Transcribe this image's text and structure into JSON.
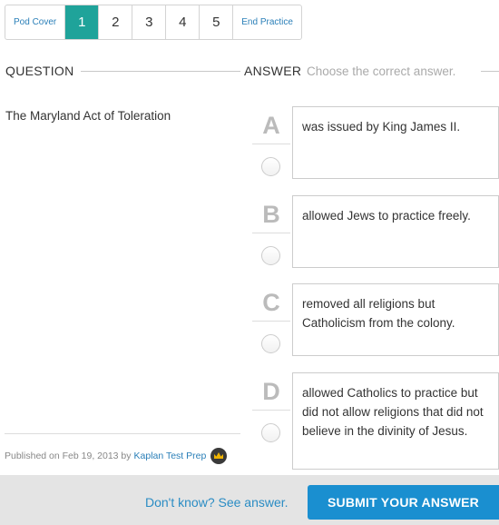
{
  "pager": {
    "cover": "Pod Cover",
    "pages": [
      "1",
      "2",
      "3",
      "4",
      "5"
    ],
    "active_page": "1",
    "end": "End Practice"
  },
  "question": {
    "heading": "QUESTION",
    "text": "The Maryland Act of Toleration"
  },
  "answer": {
    "heading": "ANSWER",
    "instruction": "Choose the correct answer.",
    "choices": [
      {
        "letter": "A",
        "text": "was issued by King James II."
      },
      {
        "letter": "B",
        "text": "allowed Jews to practice freely."
      },
      {
        "letter": "C",
        "text": "removed all religions but Catholicism from the colony."
      },
      {
        "letter": "D",
        "text": "allowed Catholics to practice but did not allow religions that did not believe in the divinity of Jesus."
      }
    ]
  },
  "published": {
    "prefix": "Published on Feb 19, 2013 by",
    "author": "Kaplan Test Prep"
  },
  "footer": {
    "dont_know": "Don't know? See answer.",
    "submit": "SUBMIT YOUR ANSWER"
  },
  "colors": {
    "active_page": "#1fa39a",
    "link": "#2a7fb8",
    "submit": "#1a8fd0"
  }
}
